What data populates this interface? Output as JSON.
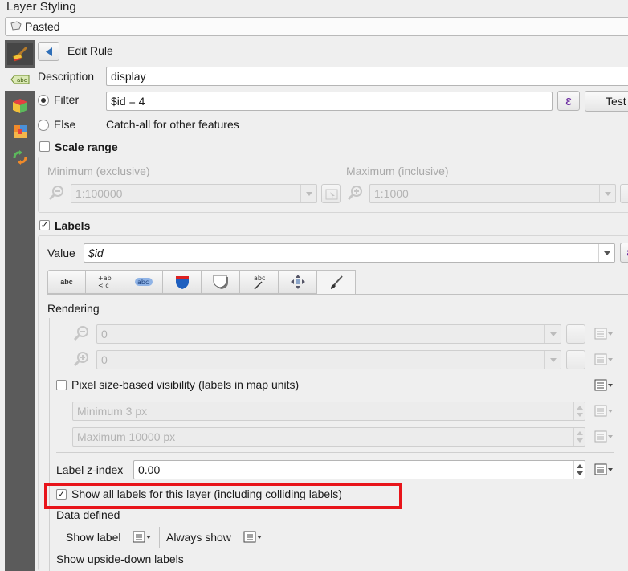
{
  "window": {
    "title": "Layer Styling"
  },
  "layer_selector": {
    "value": "Pasted"
  },
  "sidebar": {
    "items": [
      "symbology-icon",
      "labels-icon",
      "3d-view-icon",
      "masks-icon",
      "history-icon"
    ]
  },
  "header": {
    "title": "Edit Rule"
  },
  "description": {
    "label": "Description",
    "value": "display"
  },
  "filter": {
    "label": "Filter",
    "value": "$id = 4",
    "expression_button": "ε",
    "test_button": "Test"
  },
  "else": {
    "label": "Else",
    "text": "Catch-all for other features"
  },
  "scale_range": {
    "label": "Scale range",
    "min_label": "Minimum (exclusive)",
    "min_value": "1:100000",
    "max_label": "Maximum (inclusive)",
    "max_value": "1:1000"
  },
  "labels": {
    "label": "Labels",
    "value_label": "Value",
    "value": "$id",
    "expr_btn": "ε",
    "tabs": [
      "Text",
      "Formatting",
      "Buffer",
      "Background",
      "Shadow",
      "Callouts",
      "Placement",
      "Rendering"
    ],
    "tab_glyphs": {
      "text": "abc",
      "formatting": "+ab",
      "formatting2": "<c",
      "buffer": "abc",
      "callouts": "abc"
    }
  },
  "rendering": {
    "section_label": "Rendering",
    "scale_min": "0",
    "scale_max": "0",
    "pixel_vis_label": "Pixel size-based visibility (labels in map units)",
    "pixel_min": "Minimum 3 px",
    "pixel_max": "Maximum 10000 px",
    "zindex_label": "Label z-index",
    "zindex_value": "0.00",
    "show_all_label": "Show all labels for this layer (including colliding labels)",
    "data_defined_label": "Data defined",
    "show_label": "Show label",
    "always_show": "Always show",
    "upside_down": "Show upside-down labels"
  },
  "colors": {
    "highlight": "#e8141a",
    "sidebar": "#5b5b5b",
    "accent_purple": "#6a2aa0"
  }
}
